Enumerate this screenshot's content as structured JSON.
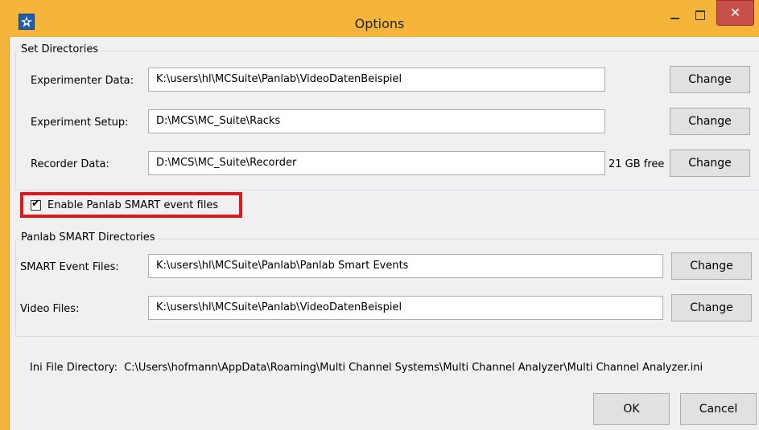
{
  "window": {
    "title": "Options",
    "controls": {
      "minimize": "–",
      "maximize": "□",
      "close": "✕"
    }
  },
  "set_directories": {
    "title": "Set Directories",
    "rows": [
      {
        "label": "Experimenter Data:",
        "value": "K:\\users\\hl\\MCSuite\\Panlab\\VideoDatenBeispiel",
        "button": "Change"
      },
      {
        "label": "Experiment Setup:",
        "value": "D:\\MCS\\MC_Suite\\Racks",
        "button": "Change"
      },
      {
        "label": "Recorder Data:",
        "value": "D:\\MCS\\MC_Suite\\Recorder",
        "button": "Change",
        "free": "21 GB free"
      }
    ]
  },
  "enable_smart": {
    "label": "Enable Panlab SMART event files",
    "checked": true,
    "check_glyph": "✔"
  },
  "smart_directories": {
    "title": "Panlab SMART Directories",
    "rows": [
      {
        "label": "SMART Event Files:",
        "value": "K:\\users\\hl\\MCSuite\\Panlab\\Panlab Smart Events",
        "button": "Change"
      },
      {
        "label": "Video Files:",
        "value": "K:\\users\\hl\\MCSuite\\Panlab\\VideoDatenBeispiel",
        "button": "Change"
      }
    ]
  },
  "ini": {
    "label": "Ini File Directory:",
    "value": "C:\\Users\\hofmann\\AppData\\Roaming\\Multi Channel Systems\\Multi Channel Analyzer\\Multi Channel Analyzer.ini"
  },
  "footer": {
    "ok": "OK",
    "cancel": "Cancel"
  },
  "colors": {
    "title_bar": "#f5b53a",
    "close_button": "#c7504a",
    "highlight_border": "#e8151a"
  }
}
